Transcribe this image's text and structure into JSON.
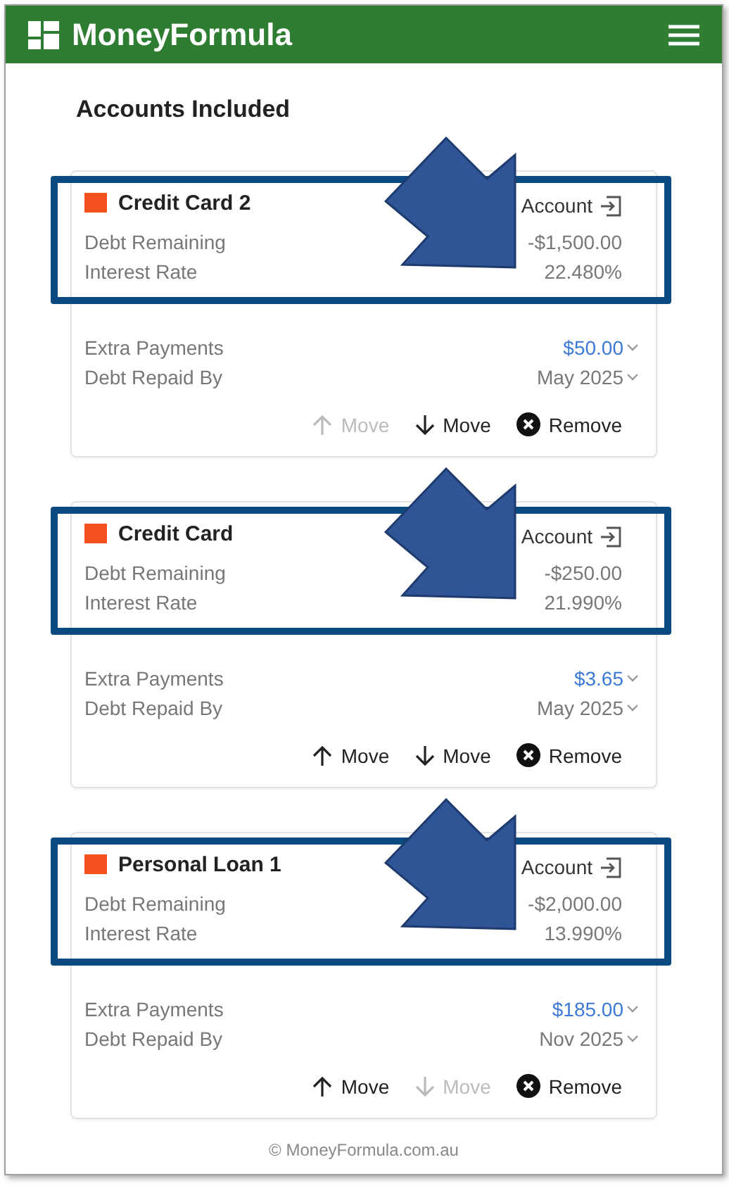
{
  "header": {
    "title": "MoneyFormula"
  },
  "section_title": "Accounts Included",
  "accounts": [
    {
      "name": "Credit Card 2",
      "color": "#f4511e",
      "link_label": "Account",
      "annotated": true,
      "details": [
        {
          "label": "Debt Remaining",
          "value": "-$1,500.00"
        },
        {
          "label": "Interest Rate",
          "value": "22.480%"
        }
      ],
      "plan": [
        {
          "label": "Extra Payments",
          "value": "$50.00",
          "color": "#3b78d8"
        },
        {
          "label": "Debt Repaid By",
          "value": "May 2025",
          "color": "#777777"
        }
      ],
      "actions": [
        {
          "kind": "up",
          "label": "Move",
          "disabled": true
        },
        {
          "kind": "down",
          "label": "Move",
          "disabled": false
        },
        {
          "kind": "remove",
          "label": "Remove",
          "disabled": false
        }
      ]
    },
    {
      "name": "Credit Card",
      "color": "#f4511e",
      "link_label": "Account",
      "annotated": true,
      "details": [
        {
          "label": "Debt Remaining",
          "value": "-$250.00"
        },
        {
          "label": "Interest Rate",
          "value": "21.990%"
        }
      ],
      "plan": [
        {
          "label": "Extra Payments",
          "value": "$3.65",
          "color": "#3b78d8"
        },
        {
          "label": "Debt Repaid By",
          "value": "May 2025",
          "color": "#777777"
        }
      ],
      "actions": [
        {
          "kind": "up",
          "label": "Move",
          "disabled": false
        },
        {
          "kind": "down",
          "label": "Move",
          "disabled": false
        },
        {
          "kind": "remove",
          "label": "Remove",
          "disabled": false
        }
      ]
    },
    {
      "name": "Personal Loan 1",
      "color": "#f4511e",
      "link_label": "Account",
      "annotated": true,
      "details": [
        {
          "label": "Debt Remaining",
          "value": "-$2,000.00"
        },
        {
          "label": "Interest Rate",
          "value": "13.990%"
        }
      ],
      "plan": [
        {
          "label": "Extra Payments",
          "value": "$185.00",
          "color": "#3b78d8"
        },
        {
          "label": "Debt Repaid By",
          "value": "Nov 2025",
          "color": "#777777"
        }
      ],
      "actions": [
        {
          "kind": "up",
          "label": "Move",
          "disabled": false
        },
        {
          "kind": "down",
          "label": "Move",
          "disabled": true
        },
        {
          "kind": "remove",
          "label": "Remove",
          "disabled": false
        }
      ]
    }
  ],
  "footer": "© MoneyFormula.com.au"
}
